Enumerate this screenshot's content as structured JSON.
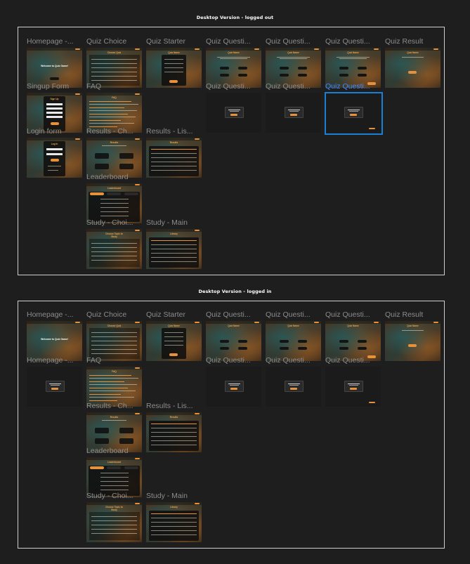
{
  "sections": [
    {
      "title": "Desktop Version - logged out",
      "frames": [
        {
          "label": "Homepage -...",
          "kind": "home",
          "heading": "Welcome to Quiz Game!"
        },
        {
          "label": "Quiz Choice",
          "kind": "table",
          "heading": "Choose Quiz"
        },
        {
          "label": "Quiz Starter",
          "kind": "starter",
          "heading": "Quiz Name"
        },
        {
          "label": "Quiz Questi...",
          "kind": "question",
          "heading": "Quiz Name"
        },
        {
          "label": "Quiz Questi...",
          "kind": "question",
          "heading": "Quiz Name"
        },
        {
          "label": "Quiz Questi...",
          "kind": "question",
          "heading": "Quiz Name"
        },
        {
          "label": "Quiz Result",
          "kind": "result",
          "heading": "Quiz Name"
        },
        {
          "label": "Singup Form",
          "kind": "form",
          "heading": "Sign Up"
        },
        {
          "label": "FAQ",
          "kind": "faq",
          "heading": "FAQ"
        },
        {
          "label": "Quiz Questi...",
          "kind": "modal",
          "heading": ""
        },
        {
          "label": "Quiz Questi...",
          "kind": "modal",
          "heading": ""
        },
        {
          "label": "Quiz Questi...",
          "kind": "modal",
          "heading": "",
          "selected": true
        },
        {
          "label": "Login form",
          "kind": "form",
          "heading": "Log In"
        },
        {
          "label": "Results - Ch...",
          "kind": "results-choice",
          "heading": "Results"
        },
        {
          "label": "Results - Lis...",
          "kind": "results-list",
          "heading": "Results"
        },
        {
          "label": "Leaderboard",
          "kind": "leaderboard",
          "heading": "Leaderboard"
        },
        {
          "label": "Study - Choi...",
          "kind": "table",
          "heading": "Choose Topic to Study"
        },
        {
          "label": "Study - Main",
          "kind": "results-list",
          "heading": "Library"
        }
      ]
    },
    {
      "title": "Desktop Version - logged in",
      "frames": [
        {
          "label": "Homepage -...",
          "kind": "home",
          "heading": "Welcome to Quiz Game!"
        },
        {
          "label": "Quiz Choice",
          "kind": "table",
          "heading": "Choose Quiz"
        },
        {
          "label": "Quiz Starter",
          "kind": "starter",
          "heading": "Quiz Name"
        },
        {
          "label": "Quiz Questi...",
          "kind": "question",
          "heading": "Quiz Name"
        },
        {
          "label": "Quiz Questi...",
          "kind": "question",
          "heading": "Quiz Name"
        },
        {
          "label": "Quiz Questi...",
          "kind": "question",
          "heading": "Quiz Name"
        },
        {
          "label": "Quiz Result",
          "kind": "result",
          "heading": "Quiz Name"
        },
        {
          "label": "Homepage -...",
          "kind": "modal",
          "heading": ""
        },
        {
          "label": "FAQ",
          "kind": "faq",
          "heading": "FAQ"
        },
        {
          "label": "Quiz Questi...",
          "kind": "modal",
          "heading": ""
        },
        {
          "label": "Quiz Questi...",
          "kind": "modal",
          "heading": ""
        },
        {
          "label": "Quiz Questi...",
          "kind": "modal",
          "heading": ""
        },
        {
          "label": "Results - Ch...",
          "kind": "results-choice",
          "heading": "Results"
        },
        {
          "label": "Results - Lis...",
          "kind": "results-list",
          "heading": "Results"
        },
        {
          "label": "Leaderboard",
          "kind": "leaderboard",
          "heading": "Leaderboard"
        },
        {
          "label": "Study - Choi...",
          "kind": "table",
          "heading": "Choose Topic to Study"
        },
        {
          "label": "Study - Main",
          "kind": "results-list",
          "heading": "Library"
        }
      ]
    }
  ],
  "colors": {
    "accent": "#e8913b",
    "selection": "#1b7fd6",
    "canvas": "#1e1e1e"
  }
}
